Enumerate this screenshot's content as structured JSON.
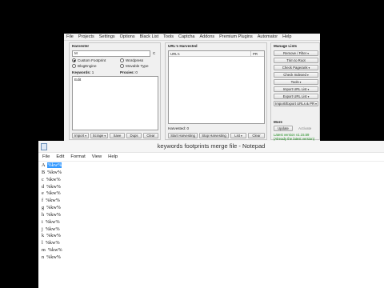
{
  "app": {
    "menu": [
      "File",
      "Projects",
      "Settings",
      "Options",
      "Black List",
      "Tools",
      "Captcha",
      "Addons",
      "Premium Plugins",
      "Automator",
      "Help"
    ],
    "harvester": {
      "title": "Harvester",
      "keyword_prefix": "M",
      "keyword_suffix": "C",
      "radios": [
        {
          "label": "Custom Footprint",
          "checked": true
        },
        {
          "label": "Wordpress",
          "checked": false
        },
        {
          "label": "BlogEngine",
          "checked": false
        },
        {
          "label": "Movable Type",
          "checked": false
        }
      ],
      "keywords_label": "Keywords:",
      "keywords_count": "1",
      "proxies_label": "Proxies:",
      "proxies_count": "0",
      "keywords_text": "Edit",
      "buttons": [
        "Import",
        "Scrape",
        "Save",
        "Dups",
        "Clear"
      ]
    },
    "urls": {
      "title": "URL's Harvested",
      "col_url": "URL's",
      "col_pr": "PR",
      "harvested_label": "Harvested:",
      "harvested_count": "0",
      "buttons": [
        "Start Harvesting",
        "Stop Harvesting",
        "List",
        "Clear"
      ]
    },
    "manage": {
      "title": "Manage Lists",
      "buttons": [
        "Remove / Filter",
        "Trim to Root",
        "Check Pagerank",
        "Check Indexed",
        "Tools",
        "Import URL List",
        "Export URL List",
        "Import/Export URLs & PR"
      ],
      "more_title": "More",
      "update_label": "Update",
      "activate_label": "Activate",
      "latest_line1": "Latest version v1.15.59",
      "latest_line2": "(Already the latest version)"
    }
  },
  "notepad": {
    "title": "keywords footprints merge file - Notepad",
    "menu": [
      "File",
      "Edit",
      "Format",
      "View",
      "Help"
    ],
    "token": "%kw%",
    "lines": [
      "A",
      "B",
      "c",
      "d",
      "e",
      "f",
      "g",
      "h",
      "i",
      "j",
      "k",
      "l",
      "m",
      "n"
    ]
  }
}
